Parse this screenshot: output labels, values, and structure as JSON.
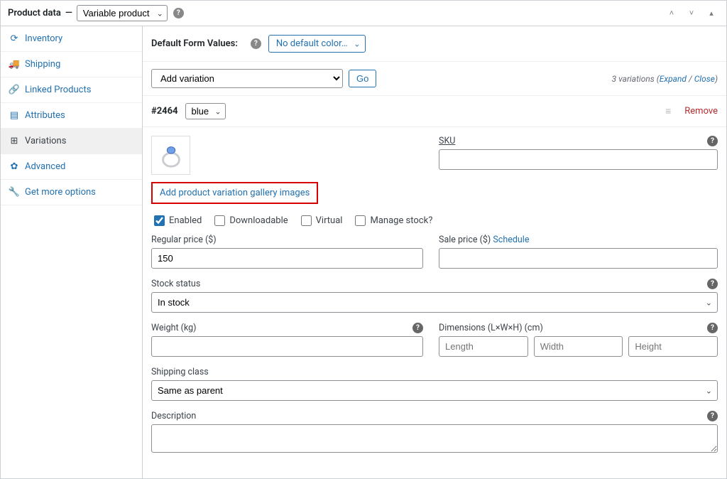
{
  "header": {
    "title": "Product data",
    "dash": "—",
    "product_type_selected": "Variable product"
  },
  "sidebar": {
    "items": [
      {
        "icon": "inventory-icon",
        "glyph": "⟳",
        "label": "Inventory"
      },
      {
        "icon": "shipping-icon",
        "glyph": "🚚",
        "label": "Shipping"
      },
      {
        "icon": "link-icon",
        "glyph": "🔗",
        "label": "Linked Products"
      },
      {
        "icon": "attributes-icon",
        "glyph": "▤",
        "label": "Attributes"
      },
      {
        "icon": "variations-icon",
        "glyph": "⊞",
        "label": "Variations",
        "active": true
      },
      {
        "icon": "gear-icon",
        "glyph": "✿",
        "label": "Advanced"
      },
      {
        "icon": "wrench-icon",
        "glyph": "🔧",
        "label": "Get more options"
      }
    ]
  },
  "default_form_values": {
    "label": "Default Form Values:",
    "selected": "No default color…"
  },
  "add_variation": {
    "label": "Add variation",
    "button": "Go",
    "count_text": "3 variations",
    "expand_text": "Expand",
    "close_text": "Close"
  },
  "variation": {
    "id": "#2464",
    "attr_selected": "blue",
    "remove": "Remove",
    "add_gallery_link": "Add product variation gallery images",
    "checks": {
      "enabled": "Enabled",
      "downloadable": "Downloadable",
      "virtual": "Virtual",
      "manage_stock": "Manage stock?"
    },
    "sku_label": "SKU",
    "regular_price_label": "Regular price ($)",
    "regular_price_value": "150",
    "sale_price_label": "Sale price ($)",
    "schedule_link": "Schedule",
    "stock_status_label": "Stock status",
    "stock_status_value": "In stock",
    "weight_label": "Weight (kg)",
    "dimensions_label": "Dimensions (L×W×H) (cm)",
    "dimensions": {
      "length": "Length",
      "width": "Width",
      "height": "Height"
    },
    "shipping_class_label": "Shipping class",
    "shipping_class_value": "Same as parent",
    "description_label": "Description"
  }
}
